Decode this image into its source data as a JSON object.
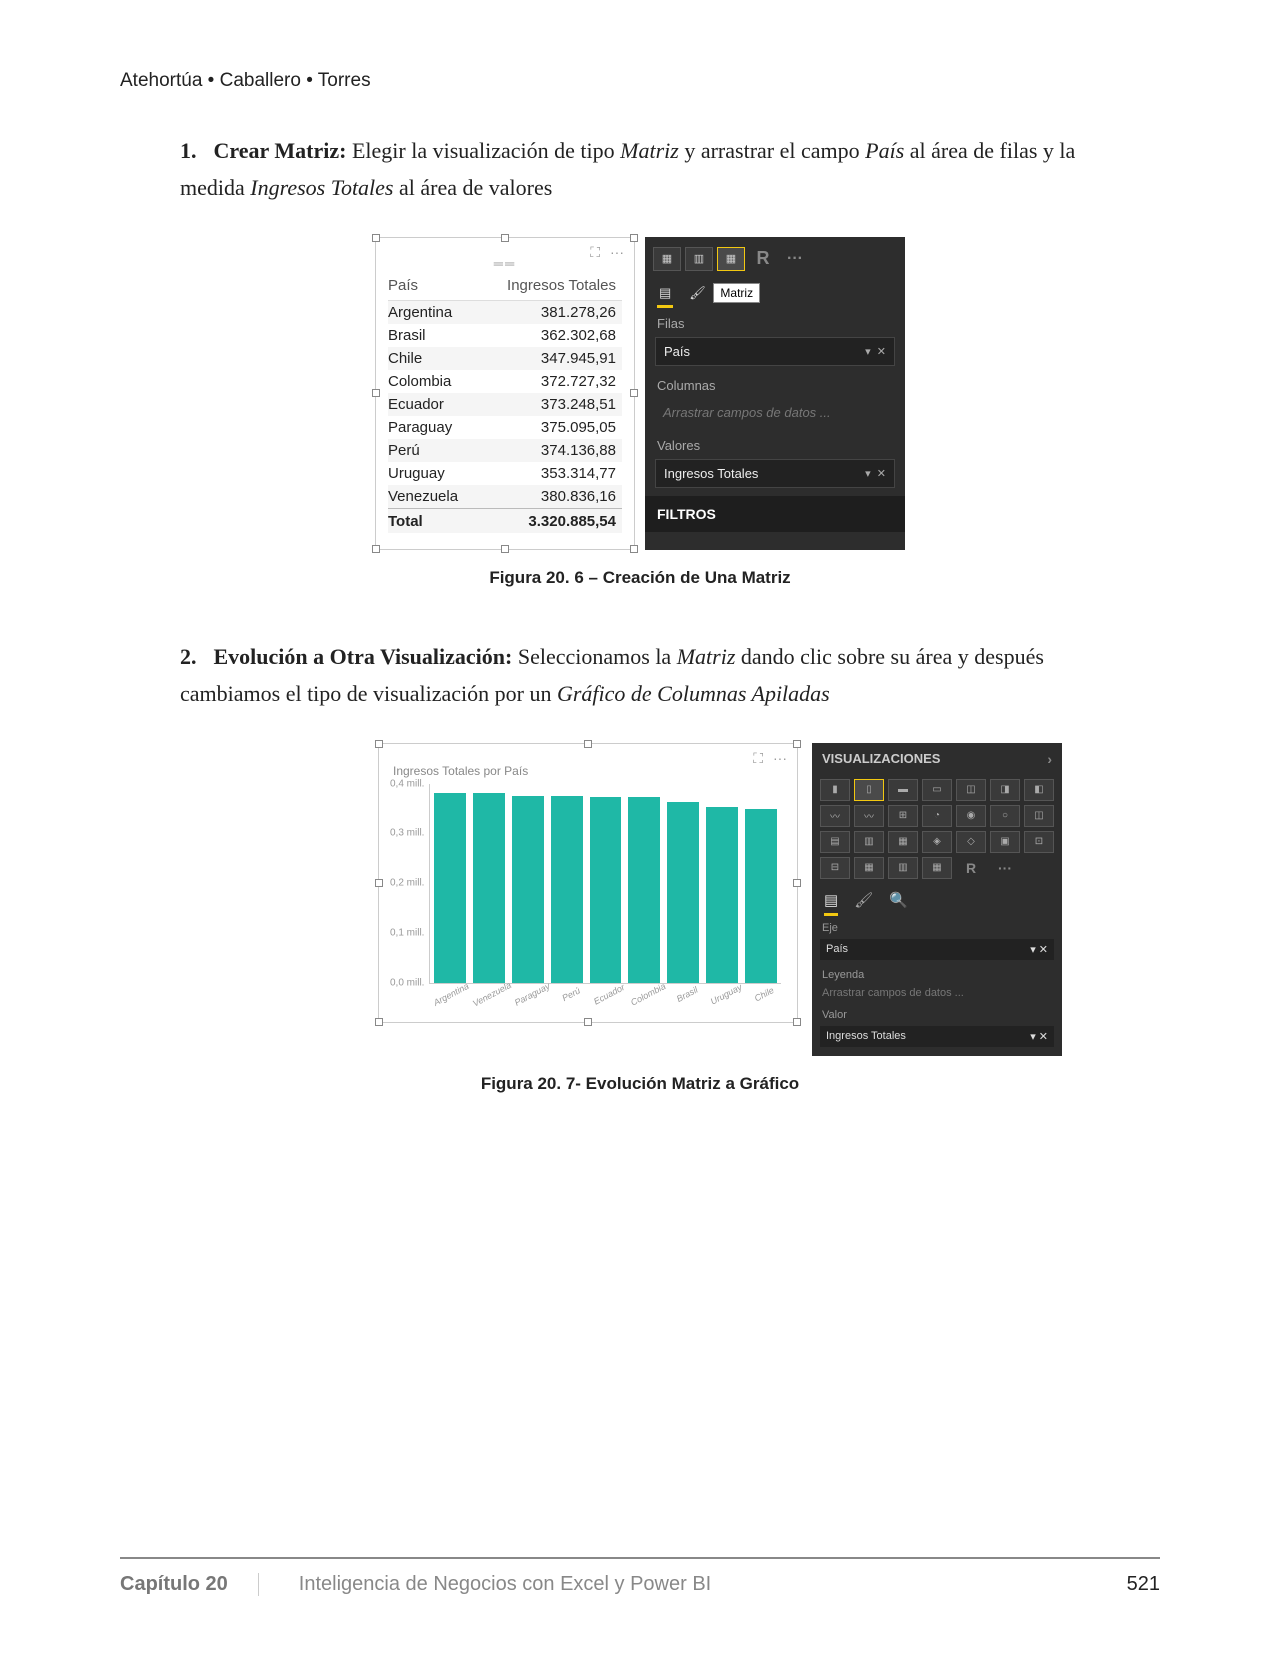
{
  "header": {
    "authors": "Atehortúa • Caballero • Torres"
  },
  "step1": {
    "num": "1.",
    "title": "Crear Matriz:",
    "text_a": " Elegir la visualización de tipo ",
    "it1": "Matriz",
    "text_b": " y arrastrar el campo ",
    "it2": "País",
    "text_c": " al área de filas y la medida ",
    "it3": "Ingresos Totales",
    "text_d": " al área de valores"
  },
  "matrix": {
    "col1": "País",
    "col2": "Ingresos Totales",
    "rows": [
      {
        "c": "Argentina",
        "v": "381.278,26"
      },
      {
        "c": "Brasil",
        "v": "362.302,68"
      },
      {
        "c": "Chile",
        "v": "347.945,91"
      },
      {
        "c": "Colombia",
        "v": "372.727,32"
      },
      {
        "c": "Ecuador",
        "v": "373.248,51"
      },
      {
        "c": "Paraguay",
        "v": "375.095,05"
      },
      {
        "c": "Perú",
        "v": "374.136,88"
      },
      {
        "c": "Uruguay",
        "v": "353.314,77"
      },
      {
        "c": "Venezuela",
        "v": "380.836,16"
      }
    ],
    "total_label": "Total",
    "total_value": "3.320.885,54"
  },
  "panel1": {
    "tooltip": "Matriz",
    "sec_rows": "Filas",
    "field_rows": "País",
    "sec_cols": "Columnas",
    "placeholder_cols": "Arrastrar campos de datos ...",
    "sec_vals": "Valores",
    "field_vals": "Ingresos Totales",
    "filters": "FILTROS",
    "r": "R",
    "dots": "···"
  },
  "fig1_caption": "Figura 20. 6 – Creación de Una Matriz",
  "step2": {
    "num": "2.",
    "title": "Evolución a Otra Visualización:",
    "text_a": " Seleccionamos la ",
    "it1": "Matriz",
    "text_b": " dando clic sobre su área y después cambiamos el tipo de visualización por un ",
    "it2": "Gráfico de Columnas Apiladas"
  },
  "chart_data": {
    "type": "bar",
    "title": "Ingresos Totales por País",
    "ylabel_unit": "mill.",
    "ylim": [
      0,
      0.4
    ],
    "yticks": [
      "0,4 mill.",
      "0,3 mill.",
      "0,2 mill.",
      "0,1 mill.",
      "0,0 mill."
    ],
    "categories": [
      "Argentina",
      "Venezuela",
      "Paraguay",
      "Perú",
      "Ecuador",
      "Colombia",
      "Brasil",
      "Uruguay",
      "Chile"
    ],
    "values": [
      381278,
      380836,
      375095,
      374137,
      373249,
      372727,
      362303,
      353315,
      347946
    ]
  },
  "panel2": {
    "header": "VISUALIZACIONES",
    "r": "R",
    "dots": "···",
    "sec_axis": "Eje",
    "field_axis": "País",
    "sec_legend": "Leyenda",
    "placeholder_legend": "Arrastrar campos de datos ...",
    "sec_value": "Valor",
    "field_value": "Ingresos Totales"
  },
  "fig2_caption": "Figura 20. 7- Evolución Matriz a Gráfico",
  "footer": {
    "chapter": "Capítulo 20",
    "title": "Inteligencia de Negocios con Excel y Power BI",
    "page": "521"
  }
}
